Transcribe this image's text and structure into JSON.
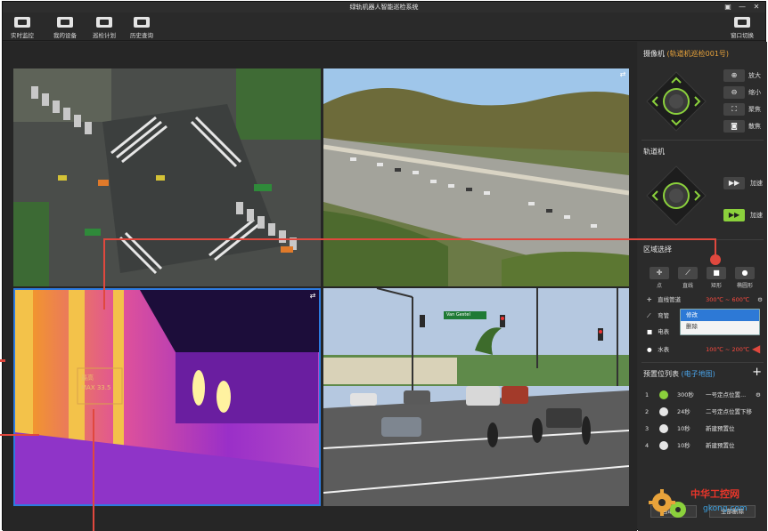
{
  "window": {
    "title": "绿轨机器人智能巡检系统",
    "controls": [
      "▣",
      "—",
      "✕"
    ]
  },
  "toolbar": {
    "items": [
      {
        "label": "实时监控",
        "icon": "camera-icon"
      },
      {
        "label": "我的设备",
        "icon": "device-icon"
      },
      {
        "label": "巡检计划",
        "icon": "list-icon"
      },
      {
        "label": "历史查询",
        "icon": "history-icon"
      }
    ],
    "window_switch_label": "窗口切换"
  },
  "thermal_overlay": {
    "label": "最高",
    "value": "MAX 33.5"
  },
  "feed_labels": {
    "street_sign": "Van Gestel"
  },
  "camera": {
    "title": "摄像机",
    "subtitle": "(轨道机巡检001号)",
    "buttons": [
      {
        "label": "放大",
        "icon": "zoom-in-icon"
      },
      {
        "label": "缩小",
        "icon": "zoom-out-icon"
      },
      {
        "label": "聚焦",
        "icon": "focus-icon"
      },
      {
        "label": "散焦",
        "icon": "defocus-icon"
      }
    ]
  },
  "track": {
    "title": "轨道机",
    "buttons": [
      {
        "label": "加速",
        "icon": "fast-forward-icon"
      },
      {
        "label": "加速",
        "icon": "fast-forward-icon"
      }
    ]
  },
  "region": {
    "title": "区域选择",
    "modes": [
      {
        "label": "点",
        "glyph": "✛"
      },
      {
        "label": "直线",
        "glyph": "⟋"
      },
      {
        "label": "矩形",
        "glyph": "■"
      },
      {
        "label": "椭圆形",
        "glyph": "●"
      }
    ],
    "rows": [
      {
        "icon": "✛",
        "name": "直线管道",
        "value": "300℃ ~ 600℃"
      },
      {
        "icon": "⟋",
        "name": "弯管",
        "value": ""
      },
      {
        "icon": "■",
        "name": "电表",
        "value": ""
      },
      {
        "icon": "●",
        "name": "水表",
        "value": "100℃ ~ 200℃"
      }
    ],
    "context_menu": [
      "修改",
      "删除"
    ]
  },
  "presets": {
    "title": "预置位列表",
    "link": "(电子地图)",
    "rows": [
      {
        "index": "1",
        "time": "300秒",
        "name": "一号定点位置..."
      },
      {
        "index": "2",
        "time": "24秒",
        "name": "二号定点位置下移"
      },
      {
        "index": "3",
        "time": "10秒",
        "name": "新建预置位"
      },
      {
        "index": "4",
        "time": "10秒",
        "name": "新建预置位"
      }
    ],
    "buttons": [
      "自动巡检",
      "全部删除"
    ]
  },
  "watermark": {
    "brand": "中华工控网",
    "url": "gkong.com"
  },
  "colors": {
    "accent": "#e8a33b",
    "link": "#4aa3e8",
    "alarm": "#ff4b40",
    "dpad_ring": "#8bd13c",
    "annotation": "#e0483e",
    "selected_feed": "#2d7be0"
  }
}
